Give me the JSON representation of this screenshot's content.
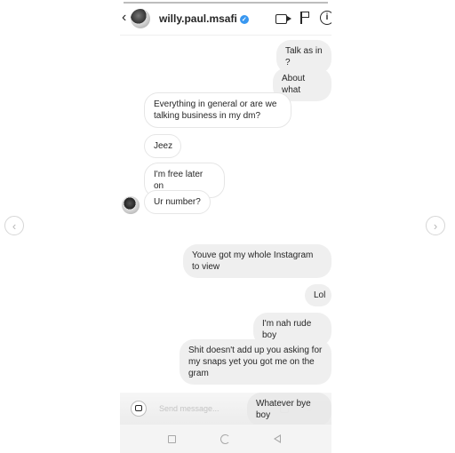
{
  "header": {
    "username": "willy.paul.msafi",
    "progress_fraction": 1.0
  },
  "messages": [
    {
      "side": "mine",
      "text": "Talk as in ?"
    },
    {
      "side": "mine",
      "text": "About what"
    },
    {
      "side": "theirs",
      "text": "Everything in general  or are we talking business in my dm?"
    },
    {
      "side": "theirs",
      "text": "Jeez"
    },
    {
      "side": "theirs",
      "text": "I'm free later on"
    },
    {
      "side": "theirs",
      "text": "Ur number?"
    },
    {
      "side": "mine",
      "text": "Youve got my whole Instagram to view"
    },
    {
      "side": "mine",
      "text": "Lol"
    },
    {
      "side": "mine",
      "text": "I'm nah rude boy"
    },
    {
      "side": "mine",
      "text": "Shit doesn't add up you asking for my snaps yet you got me on the gram"
    },
    {
      "side": "mine",
      "text": "Whatever bye boy"
    }
  ],
  "composer": {
    "placeholder": "Send message..."
  },
  "icons": {
    "back": "chevron-left-icon",
    "video": "video-call-icon",
    "flag": "flag-icon",
    "info": "info-icon",
    "camera": "camera-icon",
    "gif": "gif-icon",
    "sticker": "sticker-icon",
    "prev": "chevron-left-icon",
    "next": "chevron-right-icon"
  },
  "colors": {
    "verified": "#3897f0",
    "mine_bubble": "#efefef",
    "theirs_border": "#e6e6e6"
  }
}
